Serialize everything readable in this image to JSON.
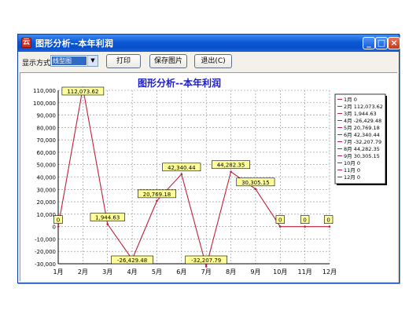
{
  "window": {
    "app_icon": "云",
    "title": "图形分析--本年利润",
    "controls": {
      "minimize": "_",
      "maximize": "□",
      "close": "×"
    }
  },
  "toolbar": {
    "display_mode_label": "显示方式",
    "display_mode_value": "线型图",
    "print_label": "打印",
    "save_image_label": "保存图片",
    "exit_label": "退出(C)"
  },
  "chart_data": {
    "type": "line",
    "title": "图形分析--本年利润",
    "categories": [
      "1月",
      "2月",
      "3月",
      "4月",
      "5月",
      "6月",
      "7月",
      "8月",
      "9月",
      "10月",
      "11月",
      "12月"
    ],
    "values": [
      0,
      112073.62,
      1944.63,
      -26429.48,
      20769.18,
      42340.44,
      -32207.79,
      44282.35,
      30305.15,
      0,
      0,
      0
    ],
    "data_labels": [
      "0",
      "112,073.62",
      "1,944.63",
      "-26,429.48",
      "20,769.18",
      "42,340.44",
      "-32,207.79",
      "44,282.35",
      "30,305.15",
      "0",
      "0",
      "0"
    ],
    "y_ticks": [
      "110,000",
      "100,000",
      "90,000",
      "80,000",
      "70,000",
      "60,000",
      "50,000",
      "40,000",
      "30,000",
      "20,000",
      "10,000",
      "0",
      "-10,000",
      "-20,000",
      "-30,000"
    ],
    "ylim": [
      -30000,
      115000
    ],
    "grid": true,
    "legend_position": "right",
    "legend": [
      "1月 0",
      "2月 112,073.62",
      "3月 1,944.63",
      "4月 -26,429.48",
      "5月 20,769.18",
      "6月 42,340.44",
      "7月 -32,207.79",
      "8月 44,282.35",
      "9月 30,305.15",
      "10月 0",
      "11月 0",
      "12月 0"
    ],
    "colors": {
      "line": "#c0203c",
      "label_bg": "#ffff99",
      "title": "#1e1ec8"
    }
  }
}
